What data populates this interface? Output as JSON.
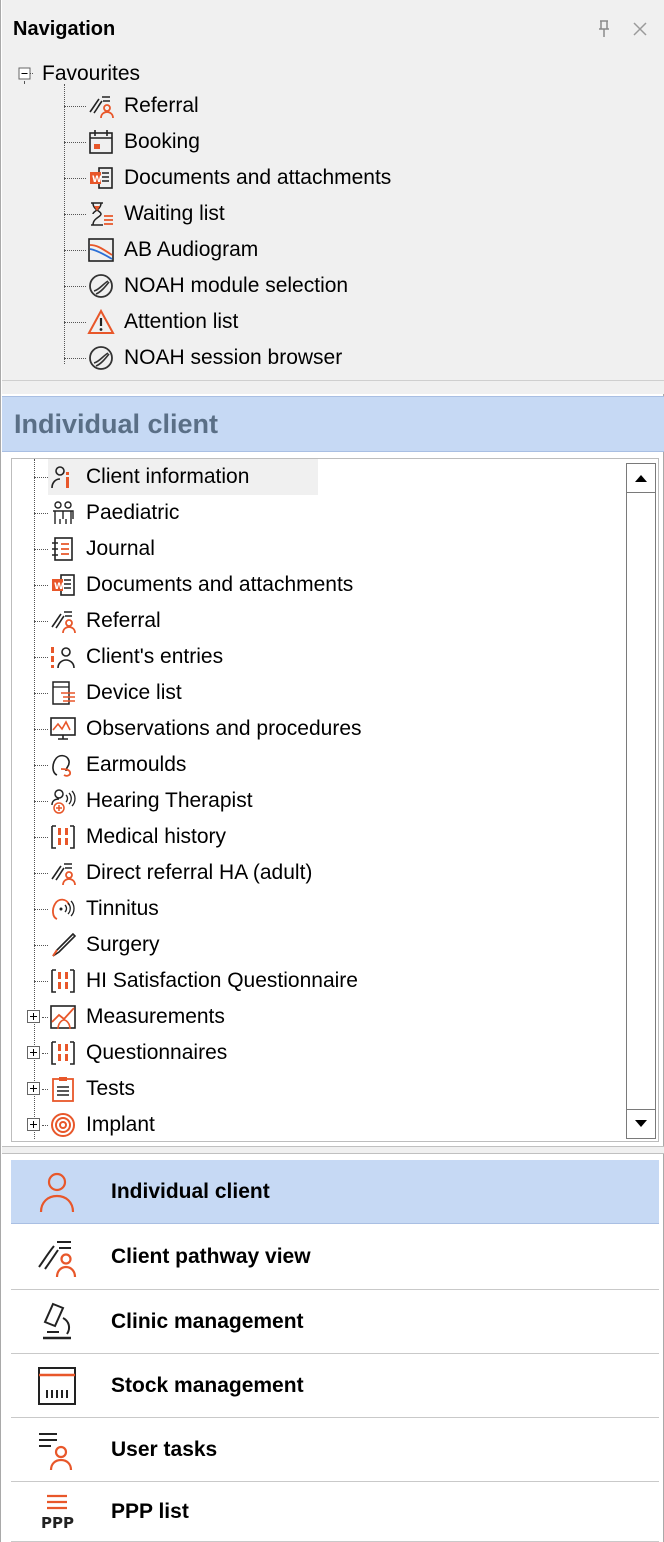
{
  "navigation": {
    "title": "Navigation",
    "favourites_label": "Favourites",
    "favourites": [
      {
        "label": "Referral",
        "icon": "referral-icon"
      },
      {
        "label": "Booking",
        "icon": "calendar-icon"
      },
      {
        "label": "Documents and attachments",
        "icon": "documents-icon"
      },
      {
        "label": "Waiting list",
        "icon": "hourglass-list-icon"
      },
      {
        "label": "AB Audiogram",
        "icon": "audiogram-icon"
      },
      {
        "label": "NOAH module selection",
        "icon": "noah-icon"
      },
      {
        "label": "Attention list",
        "icon": "warning-icon"
      },
      {
        "label": "NOAH session browser",
        "icon": "noah-icon"
      }
    ]
  },
  "client_panel": {
    "title": "Individual client",
    "items": [
      {
        "label": "Client information",
        "icon": "client-info-icon",
        "expandable": false
      },
      {
        "label": "Paediatric",
        "icon": "paediatric-icon",
        "expandable": false
      },
      {
        "label": "Journal",
        "icon": "journal-icon",
        "expandable": false
      },
      {
        "label": "Documents and attachments",
        "icon": "documents-icon",
        "expandable": false
      },
      {
        "label": "Referral",
        "icon": "referral-icon",
        "expandable": false
      },
      {
        "label": "Client's entries",
        "icon": "client-entries-icon",
        "expandable": false
      },
      {
        "label": "Device list",
        "icon": "device-list-icon",
        "expandable": false
      },
      {
        "label": "Observations and procedures",
        "icon": "monitor-icon",
        "expandable": false
      },
      {
        "label": "Earmoulds",
        "icon": "ear-icon",
        "expandable": false
      },
      {
        "label": "Hearing Therapist",
        "icon": "hearing-therapist-icon",
        "expandable": false
      },
      {
        "label": "Medical history",
        "icon": "questionnaire-icon",
        "expandable": false
      },
      {
        "label": "Direct referral HA (adult)",
        "icon": "referral-icon",
        "expandable": false
      },
      {
        "label": "Tinnitus",
        "icon": "tinnitus-icon",
        "expandable": false
      },
      {
        "label": "Surgery",
        "icon": "scalpel-icon",
        "expandable": false
      },
      {
        "label": "HI Satisfaction Questionnaire",
        "icon": "questionnaire-icon",
        "expandable": false
      },
      {
        "label": "Measurements",
        "icon": "measurements-icon",
        "expandable": true
      },
      {
        "label": "Questionnaires",
        "icon": "questionnaire-icon",
        "expandable": true
      },
      {
        "label": "Tests",
        "icon": "clipboard-icon",
        "expandable": true
      },
      {
        "label": "Implant",
        "icon": "spiral-icon",
        "expandable": true
      }
    ]
  },
  "bottom_nav": [
    {
      "label": "Individual client",
      "icon": "person-icon",
      "active": true
    },
    {
      "label": "Client pathway view",
      "icon": "pathway-icon",
      "active": false
    },
    {
      "label": "Clinic management",
      "icon": "microscope-icon",
      "active": false
    },
    {
      "label": "Stock management",
      "icon": "stock-icon",
      "active": false
    },
    {
      "label": "User tasks",
      "icon": "user-tasks-icon",
      "active": false
    },
    {
      "label": "PPP list",
      "icon": "ppp-list-icon",
      "active": false,
      "icon_text": "PPP"
    }
  ],
  "colors": {
    "accent_orange": "#e8572a",
    "header_blue": "#c6d9f4",
    "header_text": "#5a6f86",
    "panel_grey": "#f0f0f0"
  }
}
